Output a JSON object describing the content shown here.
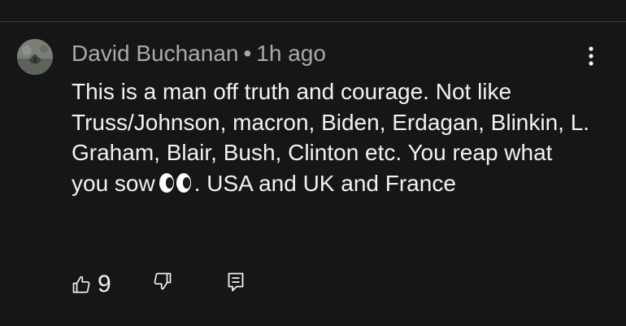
{
  "comment": {
    "author": "David Buchanan",
    "separator": "•",
    "time_ago": "1h ago",
    "text_before_emoji": "This is a man off truth and courage. Not like Truss/Johnson, macron, Biden, Erdagan, Blinkin, L. Graham, Blair, Bush, Clinton etc. You reap what you sow",
    "emoji": "eyes-emoji",
    "text_after_emoji": ". USA and UK and France",
    "like_count": "9"
  },
  "icons": {
    "like": "thumbs-up-icon",
    "dislike": "thumbs-down-icon",
    "reply": "reply-comment-icon",
    "more": "vertical-ellipsis-icon"
  },
  "colors": {
    "background": "#161616",
    "text": "#f1f1f1",
    "meta_text": "#aaaaaa"
  }
}
